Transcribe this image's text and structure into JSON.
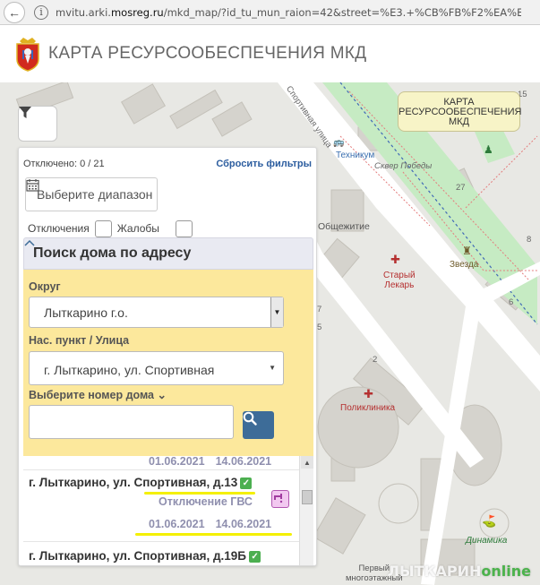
{
  "browser": {
    "url_prefix": "mvitu.arki.",
    "url_domain": "mosreg.ru",
    "url_rest": "/mkd_map/?id_tu_mun_raion=42&street=%E3.+%CB%FB%F2%EA%E0%F("
  },
  "header": {
    "title": "КАРТА РЕСУРСООБЕСПЕЧЕНИЯ МКД"
  },
  "map": {
    "tooltip": [
      "КАРТА",
      "РЕСУРСООБЕСПЕЧЕНИЯ",
      "МКД"
    ],
    "street_name": "Спортивная улица",
    "labels": {
      "tehnikum": "Техникум",
      "skver": "Сквер Победы",
      "obschezhitie": "Общежитие",
      "zvezda": "Звезда",
      "stary_lekar_1": "Старый",
      "stary_lekar_2": "Лекарь",
      "poliklinika": "Поликлиника",
      "dinamika": "Динамика",
      "perviy_1": "Первый",
      "perviy_2": "многоэтажный"
    },
    "house_numbers": {
      "n15": "15",
      "n27": "27",
      "n6": "6",
      "n8": "8",
      "n7": "7",
      "n5": "5",
      "n2": "2"
    },
    "watermark_a": "ЛЫТКАРИН",
    "watermark_b": "online"
  },
  "panel": {
    "disabled_count": "Отключено: 0 / 21",
    "reset_filters": "Сбросить фильтры",
    "date_placeholder": "Выберите диапазон",
    "outages_label": "Отключения",
    "complaints_label": "Жалобы",
    "search_title": "Поиск дома по адресу",
    "district_label": "Округ",
    "district_value": "Лыткарино г.о.",
    "locality_label": "Нас. пункт / Улица",
    "locality_value": "г. Лыткарино, ул. Спортивная",
    "house_label": "Выберите номер дома ⌄",
    "house_value": ""
  },
  "results": {
    "top_dates": [
      "01.06.2021",
      "14.06.2021"
    ],
    "items": [
      {
        "address": "г. Лыткарино, ул. Спортивная, д.13",
        "outage": "Отключение ГВС",
        "dates": [
          "01.06.2021",
          "14.06.2021"
        ]
      },
      {
        "address": "г. Лыткарино, ул. Спортивная, д.19Б"
      }
    ]
  },
  "colors": {
    "accent_blue": "#3d6c98",
    "search_bg": "#fce89c",
    "highlight": "#f4f000",
    "ok_green": "#4caf50"
  }
}
